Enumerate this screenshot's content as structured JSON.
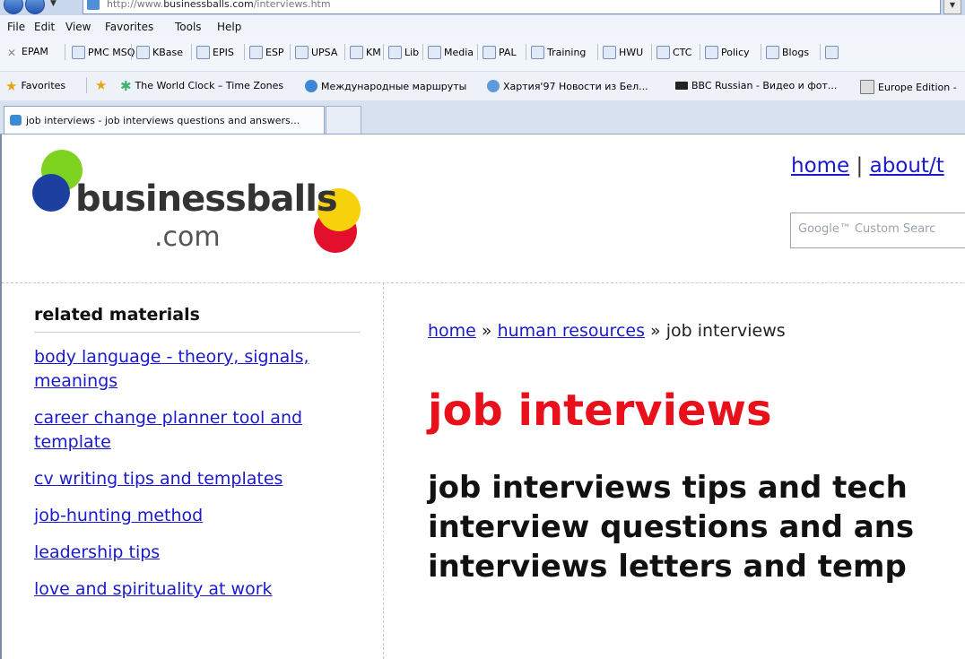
{
  "browser": {
    "url": "http://www.businessballs.com/interviews.htm",
    "url_prefix": "http://www.",
    "url_domain": "businessballs.com",
    "url_path": "/interviews.htm",
    "menu": [
      "File",
      "Edit",
      "View",
      "Favorites",
      "Tools",
      "Help"
    ],
    "links_toolbar": [
      "EPAM",
      "PMC MSQ",
      "KBase",
      "EPIS",
      "ESP",
      "UPSA",
      "KM",
      "Lib",
      "Media",
      "PAL",
      "Training",
      "HWU",
      "CTC",
      "Policy",
      "Blogs"
    ],
    "favorites_label": "Favorites",
    "favorites": [
      "The World Clock – Time Zones",
      "Международные маршруты",
      "Хартия'97 Новости из Бел...",
      "BBC Russian - Видео и фот...",
      "Europe Edition -"
    ],
    "tab_title": "job interviews - job interviews questions and answers..."
  },
  "site": {
    "logo_word": "businessballs",
    "logo_suffix": ".com",
    "topnav_home": "home",
    "topnav_sep": " | ",
    "topnav_about": "about/t",
    "search_placeholder": "Google™ Custom Searc"
  },
  "sidebar": {
    "title": "related materials",
    "links": [
      "body language - theory, signals, meanings",
      "career change planner tool and template",
      "cv writing tips and templates",
      "job-hunting method",
      "leadership tips",
      "love and spirituality at work"
    ]
  },
  "main": {
    "breadcrumb": {
      "home": "home",
      "sep1": " » ",
      "human_resources": "human resources",
      "sep2": " » ",
      "current": "job interviews"
    },
    "heading": "job interviews",
    "subheading_lines": [
      "job interviews tips and tech",
      "interview questions and ans",
      "interviews letters and temp"
    ]
  },
  "colors": {
    "heading_red": "#e8101b",
    "link_blue": "#1a1acc"
  }
}
